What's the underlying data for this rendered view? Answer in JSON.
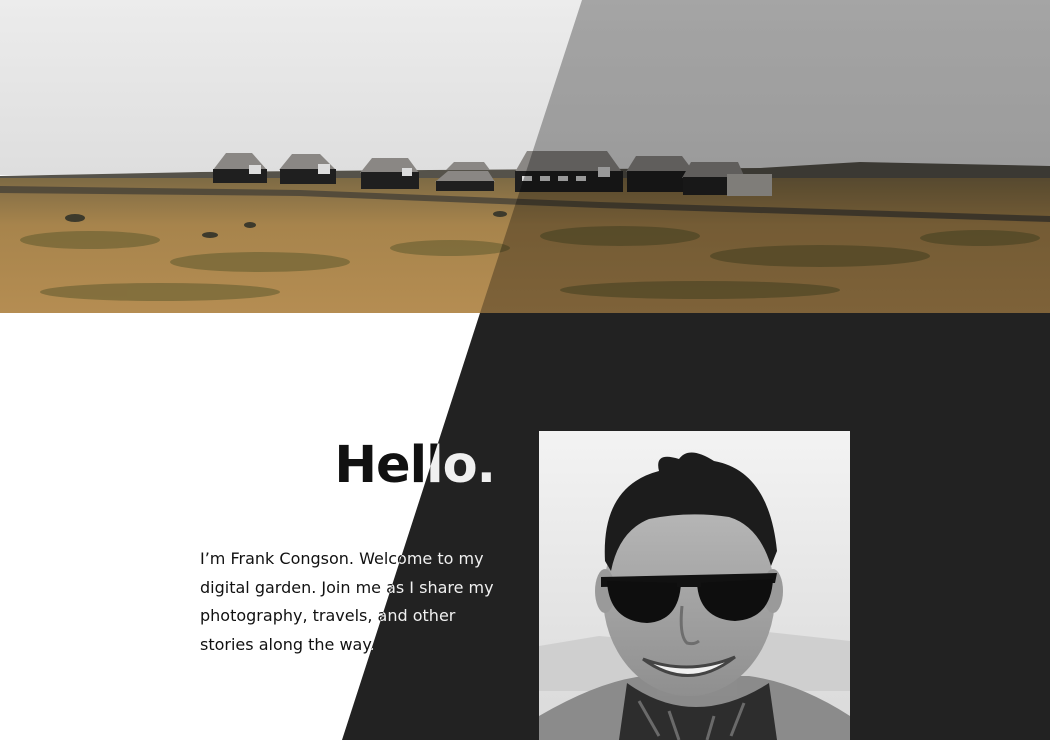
{
  "hero": {
    "scene": "icelandic-black-houses"
  },
  "intro": {
    "greeting": "Hello.",
    "bio": "I’m Frank Congson. Welcome to my digital garden. Join me as I share my photography, travels, and other stories along the way."
  },
  "portrait": {
    "subject": "frank-congson-portrait"
  },
  "colors": {
    "dark_panel": "#222222",
    "text_dark": "#111111",
    "text_light": "#f0f0f0",
    "background": "#ffffff"
  }
}
